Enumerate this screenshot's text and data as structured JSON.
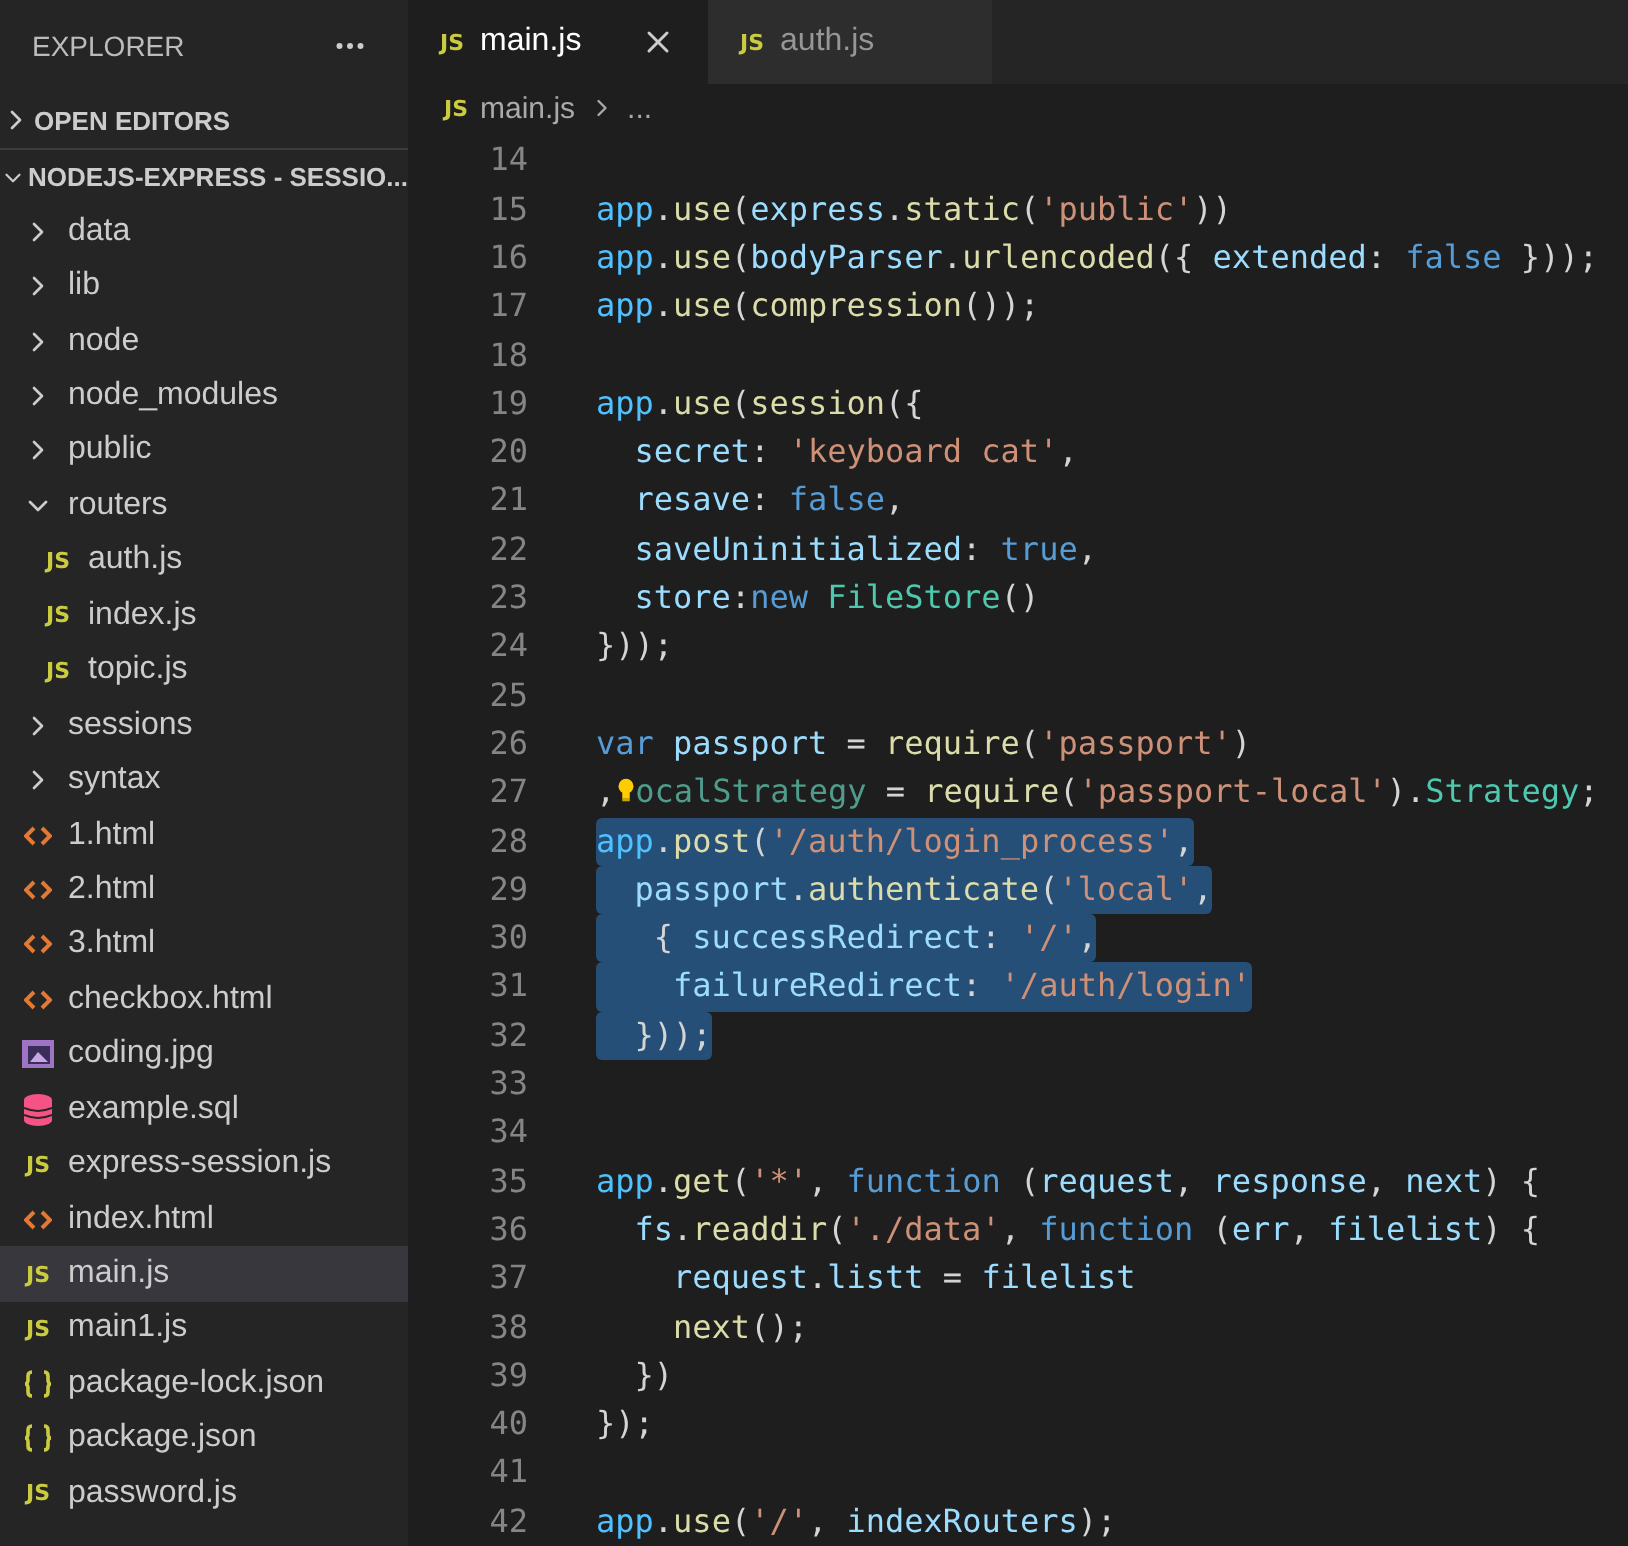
{
  "sidebar": {
    "title": "EXPLORER",
    "sections": [
      {
        "label": "OPEN EDITORS",
        "expanded": false
      },
      {
        "label": "NODEJS-EXPRESS - SESSIO...",
        "expanded": true
      }
    ],
    "items": [
      {
        "kind": "folder",
        "label": "data",
        "expanded": false,
        "selected": false
      },
      {
        "kind": "folder",
        "label": "lib",
        "expanded": false,
        "selected": false
      },
      {
        "kind": "folder",
        "label": "node",
        "expanded": false,
        "selected": false
      },
      {
        "kind": "folder",
        "label": "node_modules",
        "expanded": false,
        "selected": false
      },
      {
        "kind": "folder",
        "label": "public",
        "expanded": false,
        "selected": false
      },
      {
        "kind": "folder",
        "label": "routers",
        "expanded": true,
        "selected": false,
        "children": [
          {
            "kind": "js",
            "icon_text": "JS",
            "label": "auth.js",
            "selected": false
          },
          {
            "kind": "js",
            "icon_text": "JS",
            "label": "index.js",
            "selected": false
          },
          {
            "kind": "js",
            "icon_text": "JS",
            "label": "topic.js",
            "selected": false
          }
        ]
      },
      {
        "kind": "folder",
        "label": "sessions",
        "expanded": false,
        "selected": false
      },
      {
        "kind": "folder",
        "label": "syntax",
        "expanded": false,
        "selected": false
      },
      {
        "kind": "html",
        "label": "1.html",
        "selected": false
      },
      {
        "kind": "html",
        "label": "2.html",
        "selected": false
      },
      {
        "kind": "html",
        "label": "3.html",
        "selected": false
      },
      {
        "kind": "html",
        "label": "checkbox.html",
        "selected": false
      },
      {
        "kind": "image",
        "label": "coding.jpg",
        "selected": false
      },
      {
        "kind": "db",
        "label": "example.sql",
        "selected": false
      },
      {
        "kind": "js",
        "icon_text": "JS",
        "label": "express-session.js",
        "selected": false
      },
      {
        "kind": "html",
        "label": "index.html",
        "selected": false
      },
      {
        "kind": "js",
        "icon_text": "JS",
        "label": "main.js",
        "selected": true
      },
      {
        "kind": "js",
        "icon_text": "JS",
        "label": "main1.js",
        "selected": false
      },
      {
        "kind": "json",
        "label": "package-lock.json",
        "selected": false
      },
      {
        "kind": "json",
        "label": "package.json",
        "selected": false
      },
      {
        "kind": "js",
        "icon_text": "JS",
        "label": "password.js",
        "selected": false
      }
    ]
  },
  "tabs": [
    {
      "icon_text": "JS",
      "label": "main.js",
      "selected": true
    },
    {
      "icon_text": "JS",
      "label": "auth.js",
      "selected": false
    }
  ],
  "breadcrumb": {
    "icon_text": "JS",
    "file": "main.js",
    "rest": "..."
  },
  "editor": {
    "lines": [
      {
        "number": "14",
        "selected": false
      },
      {
        "number": "15",
        "selected": false,
        "tokens": [
          {
            "kind": "app",
            "text": "app"
          },
          {
            "kind": "p",
            "text": "."
          },
          {
            "kind": "fn",
            "text": "use"
          },
          {
            "kind": "p",
            "text": "("
          },
          {
            "kind": "var",
            "text": "express"
          },
          {
            "kind": "p",
            "text": "."
          },
          {
            "kind": "fn",
            "text": "static"
          },
          {
            "kind": "p",
            "text": "("
          },
          {
            "kind": "str",
            "text": "'public'"
          },
          {
            "kind": "p",
            "text": "))"
          }
        ]
      },
      {
        "number": "16",
        "selected": false,
        "tokens": [
          {
            "kind": "app",
            "text": "app"
          },
          {
            "kind": "p",
            "text": "."
          },
          {
            "kind": "fn",
            "text": "use"
          },
          {
            "kind": "p",
            "text": "("
          },
          {
            "kind": "var",
            "text": "bodyParser"
          },
          {
            "kind": "p",
            "text": "."
          },
          {
            "kind": "fn",
            "text": "urlencoded"
          },
          {
            "kind": "p",
            "text": "({ "
          },
          {
            "kind": "var",
            "text": "extended"
          },
          {
            "kind": "p",
            "text": ": "
          },
          {
            "kind": "kw",
            "text": "false"
          },
          {
            "kind": "p",
            "text": " }));"
          }
        ]
      },
      {
        "number": "17",
        "selected": false,
        "tokens": [
          {
            "kind": "app",
            "text": "app"
          },
          {
            "kind": "p",
            "text": "."
          },
          {
            "kind": "fn",
            "text": "use"
          },
          {
            "kind": "p",
            "text": "("
          },
          {
            "kind": "fn",
            "text": "compression"
          },
          {
            "kind": "p",
            "text": "());"
          }
        ]
      },
      {
        "number": "18",
        "selected": false
      },
      {
        "number": "19",
        "selected": false,
        "tokens": [
          {
            "kind": "app",
            "text": "app"
          },
          {
            "kind": "p",
            "text": "."
          },
          {
            "kind": "fn",
            "text": "use"
          },
          {
            "kind": "p",
            "text": "("
          },
          {
            "kind": "fn",
            "text": "session"
          },
          {
            "kind": "p",
            "text": "({"
          }
        ]
      },
      {
        "number": "20",
        "selected": false,
        "tokens": [
          {
            "kind": "var",
            "text": "  secret"
          },
          {
            "kind": "p",
            "text": ": "
          },
          {
            "kind": "str",
            "text": "'keyboard cat'"
          },
          {
            "kind": "p",
            "text": ","
          }
        ]
      },
      {
        "number": "21",
        "selected": false,
        "tokens": [
          {
            "kind": "var",
            "text": "  resave"
          },
          {
            "kind": "p",
            "text": ": "
          },
          {
            "kind": "kw",
            "text": "false"
          },
          {
            "kind": "p",
            "text": ","
          }
        ]
      },
      {
        "number": "22",
        "selected": false,
        "tokens": [
          {
            "kind": "var",
            "text": "  saveUninitialized"
          },
          {
            "kind": "p",
            "text": ": "
          },
          {
            "kind": "kw",
            "text": "true"
          },
          {
            "kind": "p",
            "text": ","
          }
        ]
      },
      {
        "number": "23",
        "selected": false,
        "tokens": [
          {
            "kind": "var",
            "text": "  store"
          },
          {
            "kind": "p",
            "text": ":"
          },
          {
            "kind": "kw",
            "text": "new "
          },
          {
            "kind": "type",
            "text": "FileStore"
          },
          {
            "kind": "p",
            "text": "()"
          }
        ]
      },
      {
        "number": "24",
        "selected": false,
        "tokens": [
          {
            "kind": "p",
            "text": "}));"
          }
        ]
      },
      {
        "number": "25",
        "selected": false
      },
      {
        "number": "26",
        "selected": false,
        "tokens": [
          {
            "kind": "kw",
            "text": "var "
          },
          {
            "kind": "var",
            "text": "passport"
          },
          {
            "kind": "p",
            "text": " = "
          },
          {
            "kind": "fn",
            "text": "require"
          },
          {
            "kind": "p",
            "text": "("
          },
          {
            "kind": "str",
            "text": "'passport'"
          },
          {
            "kind": "p",
            "text": ")"
          }
        ]
      },
      {
        "number": "27",
        "selected": false,
        "lightbulb": true,
        "tokens": [
          {
            "kind": "p",
            "text": ","
          },
          {
            "kind": "unused",
            "text": "ocalStrategy"
          },
          {
            "kind": "p",
            "text": " = "
          },
          {
            "kind": "fn",
            "text": "require"
          },
          {
            "kind": "p",
            "text": "("
          },
          {
            "kind": "str",
            "text": "'passport-local'"
          },
          {
            "kind": "p",
            "text": ")."
          },
          {
            "kind": "type",
            "text": "Strategy"
          },
          {
            "kind": "p",
            "text": ";"
          }
        ]
      },
      {
        "number": "28",
        "selected": true,
        "tokens": [
          {
            "kind": "app",
            "text": "app"
          },
          {
            "kind": "p",
            "text": "."
          },
          {
            "kind": "fn",
            "text": "post"
          },
          {
            "kind": "p",
            "text": "("
          },
          {
            "kind": "str",
            "text": "'/auth/login_process'"
          },
          {
            "kind": "p",
            "text": ","
          }
        ]
      },
      {
        "number": "29",
        "selected": true,
        "tokens": [
          {
            "kind": "var",
            "text": "  passport"
          },
          {
            "kind": "p",
            "text": "."
          },
          {
            "kind": "fn",
            "text": "authenticate"
          },
          {
            "kind": "p",
            "text": "("
          },
          {
            "kind": "str",
            "text": "'local'"
          },
          {
            "kind": "p",
            "text": ","
          }
        ]
      },
      {
        "number": "30",
        "selected": true,
        "tokens": [
          {
            "kind": "p",
            "text": "   { "
          },
          {
            "kind": "var",
            "text": "successRedirect"
          },
          {
            "kind": "p",
            "text": ": "
          },
          {
            "kind": "str",
            "text": "'/'"
          },
          {
            "kind": "p",
            "text": ","
          }
        ]
      },
      {
        "number": "31",
        "selected": true,
        "tokens": [
          {
            "kind": "var",
            "text": "    failureRedirect"
          },
          {
            "kind": "p",
            "text": ": "
          },
          {
            "kind": "str",
            "text": "'/auth/login'"
          }
        ]
      },
      {
        "number": "32",
        "selected": true,
        "tokens": [
          {
            "kind": "p",
            "text": "  }));"
          }
        ]
      },
      {
        "number": "33",
        "selected": false
      },
      {
        "number": "34",
        "selected": false
      },
      {
        "number": "35",
        "selected": false,
        "tokens": [
          {
            "kind": "app",
            "text": "app"
          },
          {
            "kind": "p",
            "text": "."
          },
          {
            "kind": "fn",
            "text": "get"
          },
          {
            "kind": "p",
            "text": "("
          },
          {
            "kind": "str",
            "text": "'*'"
          },
          {
            "kind": "p",
            "text": ", "
          },
          {
            "kind": "kw",
            "text": "function"
          },
          {
            "kind": "p",
            "text": " ("
          },
          {
            "kind": "var",
            "text": "request"
          },
          {
            "kind": "p",
            "text": ", "
          },
          {
            "kind": "var",
            "text": "response"
          },
          {
            "kind": "p",
            "text": ", "
          },
          {
            "kind": "var",
            "text": "next"
          },
          {
            "kind": "p",
            "text": ") {"
          }
        ]
      },
      {
        "number": "36",
        "selected": false,
        "tokens": [
          {
            "kind": "var",
            "text": "  fs"
          },
          {
            "kind": "p",
            "text": "."
          },
          {
            "kind": "fn",
            "text": "readdir"
          },
          {
            "kind": "p",
            "text": "("
          },
          {
            "kind": "str",
            "text": "'./data'"
          },
          {
            "kind": "p",
            "text": ", "
          },
          {
            "kind": "kw",
            "text": "function"
          },
          {
            "kind": "p",
            "text": " ("
          },
          {
            "kind": "var",
            "text": "err"
          },
          {
            "kind": "p",
            "text": ", "
          },
          {
            "kind": "var",
            "text": "filelist"
          },
          {
            "kind": "p",
            "text": ") {"
          }
        ]
      },
      {
        "number": "37",
        "selected": false,
        "tokens": [
          {
            "kind": "var",
            "text": "    request"
          },
          {
            "kind": "p",
            "text": "."
          },
          {
            "kind": "var",
            "text": "listt"
          },
          {
            "kind": "p",
            "text": " = "
          },
          {
            "kind": "var",
            "text": "filelist"
          }
        ]
      },
      {
        "number": "38",
        "selected": false,
        "tokens": [
          {
            "kind": "fn",
            "text": "    next"
          },
          {
            "kind": "p",
            "text": "();"
          }
        ]
      },
      {
        "number": "39",
        "selected": false,
        "tokens": [
          {
            "kind": "p",
            "text": "  })"
          }
        ]
      },
      {
        "number": "40",
        "selected": false,
        "tokens": [
          {
            "kind": "p",
            "text": "});"
          }
        ]
      },
      {
        "number": "41",
        "selected": false
      },
      {
        "number": "42",
        "selected": false,
        "tokens": [
          {
            "kind": "app",
            "text": "app"
          },
          {
            "kind": "p",
            "text": "."
          },
          {
            "kind": "fn",
            "text": "use"
          },
          {
            "kind": "p",
            "text": "("
          },
          {
            "kind": "str",
            "text": "'/'"
          },
          {
            "kind": "p",
            "text": ", "
          },
          {
            "kind": "var",
            "text": "indexRouters"
          },
          {
            "kind": "p",
            "text": ");"
          }
        ]
      }
    ]
  }
}
